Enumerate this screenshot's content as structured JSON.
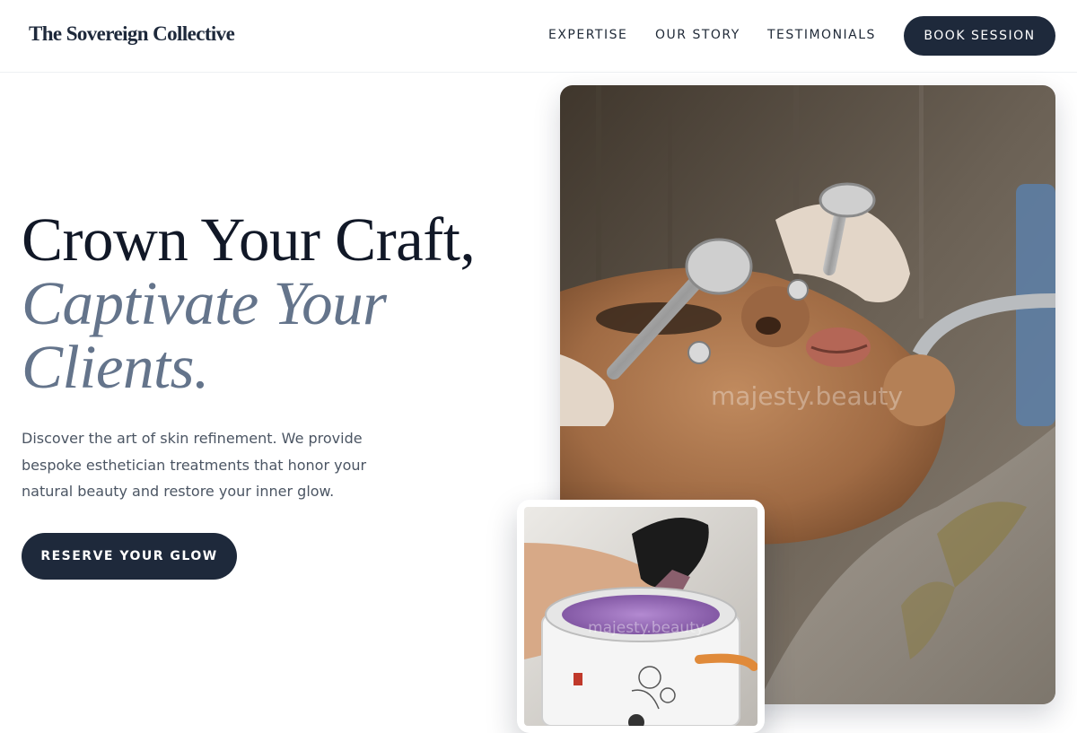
{
  "brand": {
    "name": "The Sovereign Collective"
  },
  "nav": {
    "links": [
      "EXPERTISE",
      "OUR STORY",
      "TESTIMONIALS"
    ],
    "book_label": "BOOK SESSION"
  },
  "hero": {
    "headline_line1": "Crown Your Craft,",
    "headline_line2": "Captivate Your",
    "headline_line3": "Clients.",
    "description": "Discover the art of skin refinement. We provide bespoke esthetician treatments that honor your natural beauty and restore your inner glow.",
    "cta_label": "RESERVE YOUR GLOW"
  },
  "images": {
    "main_watermark": "majesty.beauty",
    "small_watermark": "majesty.beauty"
  },
  "colors": {
    "primary": "#1e293b",
    "accent_text": "#64748b",
    "body_text": "#4b5563"
  }
}
